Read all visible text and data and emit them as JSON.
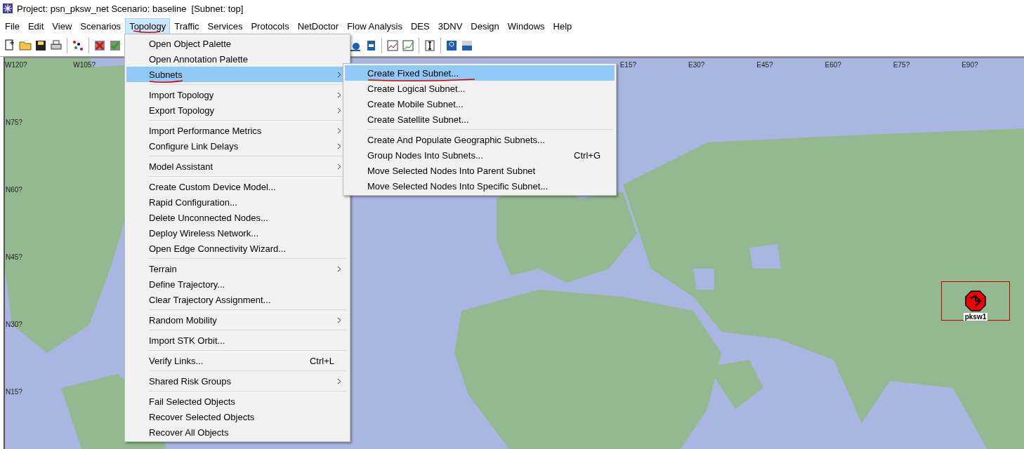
{
  "window": {
    "title": "Project: psn_pksw_net Scenario: baseline  [Subnet: top]"
  },
  "menubar": [
    {
      "label": "File",
      "selected": false,
      "underlined": false
    },
    {
      "label": "Edit",
      "selected": false,
      "underlined": false
    },
    {
      "label": "View",
      "selected": false,
      "underlined": false
    },
    {
      "label": "Scenarios",
      "selected": false,
      "underlined": false
    },
    {
      "label": "Topology",
      "selected": true,
      "underlined": true
    },
    {
      "label": "Traffic",
      "selected": false,
      "underlined": false
    },
    {
      "label": "Services",
      "selected": false,
      "underlined": false
    },
    {
      "label": "Protocols",
      "selected": false,
      "underlined": false
    },
    {
      "label": "NetDoctor",
      "selected": false,
      "underlined": false
    },
    {
      "label": "Flow Analysis",
      "selected": false,
      "underlined": false
    },
    {
      "label": "DES",
      "selected": false,
      "underlined": false
    },
    {
      "label": "3DNV",
      "selected": false,
      "underlined": false
    },
    {
      "label": "Design",
      "selected": false,
      "underlined": false
    },
    {
      "label": "Windows",
      "selected": false,
      "underlined": false
    },
    {
      "label": "Help",
      "selected": false,
      "underlined": false
    }
  ],
  "map": {
    "kind": "picture",
    "longitude_labels": [
      "W120?",
      "W105?",
      "E15?",
      "E30?",
      "E45?",
      "E60?",
      "E75?",
      "E90?"
    ],
    "latitude_labels": [
      "N75?",
      "N60?",
      "N45?",
      "N30?",
      "N15?"
    ],
    "nodes": [
      {
        "label": "pksw1",
        "selected": true
      }
    ]
  },
  "topology_menu": {
    "sections": [
      [
        {
          "label": "Open Object Palette",
          "selected": false,
          "underlined": false,
          "submenu": false
        },
        {
          "label": "Open Annotation Palette",
          "selected": false,
          "underlined": false,
          "submenu": false
        },
        {
          "label": "Subnets",
          "selected": true,
          "underlined": true,
          "submenu": true
        }
      ],
      [
        {
          "label": "Import Topology",
          "selected": false,
          "underlined": false,
          "submenu": true
        },
        {
          "label": "Export Topology",
          "selected": false,
          "underlined": false,
          "submenu": true
        }
      ],
      [
        {
          "label": "Import Performance Metrics",
          "selected": false,
          "underlined": false,
          "submenu": true
        },
        {
          "label": "Configure Link Delays",
          "selected": false,
          "underlined": false,
          "submenu": true
        }
      ],
      [
        {
          "label": "Model Assistant",
          "selected": false,
          "underlined": false,
          "submenu": true
        }
      ],
      [
        {
          "label": "Create Custom Device Model...",
          "selected": false,
          "underlined": false,
          "submenu": false
        },
        {
          "label": "Rapid Configuration...",
          "selected": false,
          "underlined": false,
          "submenu": false
        },
        {
          "label": "Delete Unconnected Nodes...",
          "selected": false,
          "underlined": false,
          "submenu": false
        },
        {
          "label": "Deploy Wireless Network...",
          "selected": false,
          "underlined": false,
          "submenu": false
        },
        {
          "label": "Open Edge Connectivity Wizard...",
          "selected": false,
          "underlined": false,
          "submenu": false
        }
      ],
      [
        {
          "label": "Terrain",
          "selected": false,
          "underlined": false,
          "submenu": true
        },
        {
          "label": "Define Trajectory...",
          "selected": false,
          "underlined": false,
          "submenu": false
        },
        {
          "label": "Clear Trajectory Assignment...",
          "selected": false,
          "underlined": false,
          "submenu": false
        }
      ],
      [
        {
          "label": "Random Mobility",
          "selected": false,
          "underlined": false,
          "submenu": true
        }
      ],
      [
        {
          "label": "Import STK Orbit...",
          "selected": false,
          "underlined": false,
          "submenu": false
        }
      ],
      [
        {
          "label": "Verify Links...",
          "selected": false,
          "underlined": false,
          "submenu": false,
          "shortcut": "Ctrl+L"
        }
      ],
      [
        {
          "label": "Shared Risk Groups",
          "selected": false,
          "underlined": false,
          "submenu": true
        }
      ],
      [
        {
          "label": "Fail Selected Objects",
          "selected": false,
          "underlined": false,
          "submenu": false
        },
        {
          "label": "Recover Selected Objects",
          "selected": false,
          "underlined": false,
          "submenu": false
        },
        {
          "label": "Recover All Objects",
          "selected": false,
          "underlined": false,
          "submenu": false
        }
      ]
    ]
  },
  "subnets_submenu": {
    "sections": [
      [
        {
          "label": "Create Fixed Subnet...",
          "selected": true,
          "underlined": true,
          "submenu": false
        },
        {
          "label": "Create Logical Subnet...",
          "selected": false,
          "underlined": false,
          "submenu": false
        },
        {
          "label": "Create Mobile Subnet...",
          "selected": false,
          "underlined": false,
          "submenu": false
        },
        {
          "label": "Create Satellite Subnet...",
          "selected": false,
          "underlined": false,
          "submenu": false
        }
      ],
      [
        {
          "label": "Create And Populate Geographic Subnets...",
          "selected": false,
          "underlined": false,
          "submenu": false
        },
        {
          "label": "Group Nodes Into Subnets...",
          "selected": false,
          "underlined": false,
          "submenu": false,
          "shortcut": "Ctrl+G"
        },
        {
          "label": "Move Selected Nodes Into Parent Subnet",
          "selected": false,
          "underlined": false,
          "submenu": false
        },
        {
          "label": "Move Selected Nodes Into Specific Subnet...",
          "selected": false,
          "underlined": false,
          "submenu": false
        }
      ]
    ]
  }
}
